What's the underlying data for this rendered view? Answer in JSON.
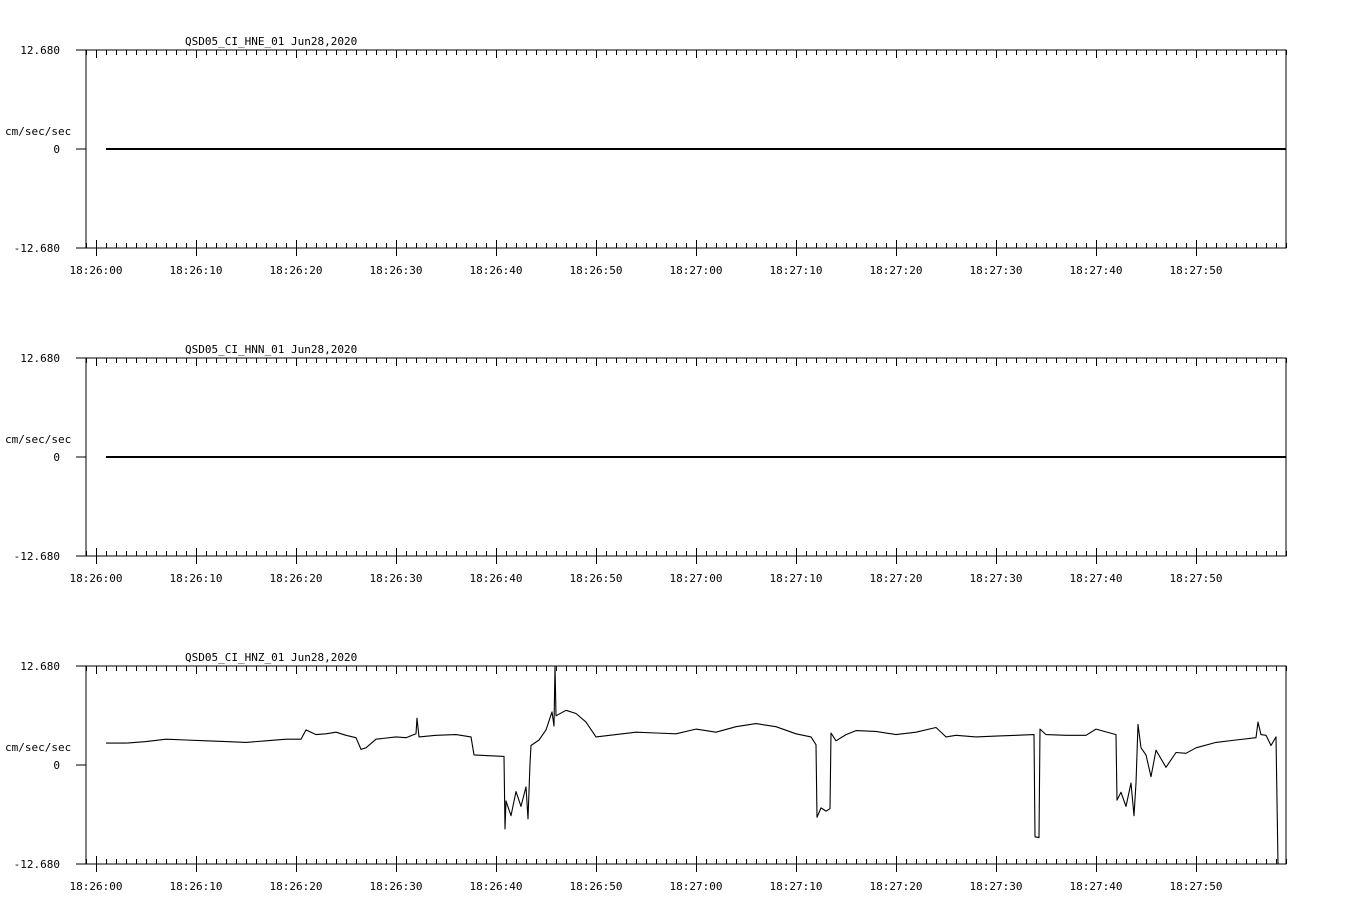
{
  "chart_data": [
    {
      "type": "line",
      "title": "QSD05_CI_HNE_01  Jun28,2020",
      "ylabel": "cm/sec/sec",
      "ylim": [
        -12.68,
        12.68
      ],
      "y_ticks": [
        "12.680",
        "0",
        "-12.680"
      ],
      "x_ticks": [
        "18:26:00",
        "18:26:10",
        "18:26:20",
        "18:26:30",
        "18:26:40",
        "18:26:50",
        "18:27:00",
        "18:27:10",
        "18:27:20",
        "18:27:30",
        "18:27:40",
        "18:27:50"
      ],
      "xlim_seconds": [
        -1,
        119
      ],
      "series": [
        {
          "points": [
            [
              1,
              0
            ],
            [
              119,
              0
            ]
          ]
        }
      ]
    },
    {
      "type": "line",
      "title": "QSD05_CI_HNN_01  Jun28,2020",
      "ylabel": "cm/sec/sec",
      "ylim": [
        -12.68,
        12.68
      ],
      "y_ticks": [
        "12.680",
        "0",
        "-12.680"
      ],
      "x_ticks": [
        "18:26:00",
        "18:26:10",
        "18:26:20",
        "18:26:30",
        "18:26:40",
        "18:26:50",
        "18:27:00",
        "18:27:10",
        "18:27:20",
        "18:27:30",
        "18:27:40",
        "18:27:50"
      ],
      "xlim_seconds": [
        -1,
        119
      ],
      "series": [
        {
          "points": [
            [
              1,
              0
            ],
            [
              119,
              0
            ]
          ]
        }
      ]
    },
    {
      "type": "line",
      "title": "QSD05_CI_HNZ_01  Jun28,2020",
      "ylabel": "cm/sec/sec",
      "ylim": [
        -12.68,
        12.68
      ],
      "y_ticks": [
        "12.680",
        "0",
        "-12.680"
      ],
      "x_ticks": [
        "18:26:00",
        "18:26:10",
        "18:26:20",
        "18:26:30",
        "18:26:40",
        "18:26:50",
        "18:27:00",
        "18:27:10",
        "18:27:20",
        "18:27:30",
        "18:27:40",
        "18:27:50"
      ],
      "xlim_seconds": [
        -1,
        119
      ],
      "series": [
        {
          "points": [
            [
              1,
              2.8
            ],
            [
              3,
              2.8
            ],
            [
              5,
              3.0
            ],
            [
              7,
              3.3
            ],
            [
              9,
              3.2
            ],
            [
              11,
              3.1
            ],
            [
              13,
              3.0
            ],
            [
              15,
              2.9
            ],
            [
              17,
              3.1
            ],
            [
              19,
              3.3
            ],
            [
              20.5,
              3.3
            ],
            [
              21,
              4.5
            ],
            [
              22,
              3.9
            ],
            [
              23,
              4.0
            ],
            [
              24,
              4.2
            ],
            [
              25,
              3.8
            ],
            [
              26,
              3.5
            ],
            [
              26.5,
              2.0
            ],
            [
              27,
              2.2
            ],
            [
              28,
              3.3
            ],
            [
              30,
              3.6
            ],
            [
              31,
              3.5
            ],
            [
              32,
              4.0
            ],
            [
              32.1,
              6.0
            ],
            [
              32.3,
              3.6
            ],
            [
              34,
              3.8
            ],
            [
              36,
              3.9
            ],
            [
              37.5,
              3.6
            ],
            [
              37.8,
              1.3
            ],
            [
              39,
              1.2
            ],
            [
              40.8,
              1.1
            ],
            [
              40.9,
              -8.2
            ],
            [
              41,
              -4.6
            ],
            [
              41.5,
              -6.5
            ],
            [
              42,
              -3.4
            ],
            [
              42.5,
              -5.3
            ],
            [
              43,
              -2.8
            ],
            [
              43.2,
              -6.9
            ],
            [
              43.4,
              0.2
            ],
            [
              43.5,
              2.5
            ],
            [
              44.3,
              3.2
            ],
            [
              45,
              4.5
            ],
            [
              45.6,
              6.8
            ],
            [
              45.8,
              5.0
            ],
            [
              45.9,
              12.68
            ],
            [
              46,
              6.3
            ],
            [
              47,
              7.0
            ],
            [
              48,
              6.6
            ],
            [
              49,
              5.5
            ],
            [
              50,
              3.6
            ],
            [
              52,
              3.9
            ],
            [
              54,
              4.2
            ],
            [
              56,
              4.1
            ],
            [
              58,
              4.0
            ],
            [
              60,
              4.6
            ],
            [
              62,
              4.2
            ],
            [
              64,
              4.9
            ],
            [
              66,
              5.3
            ],
            [
              68,
              4.9
            ],
            [
              70,
              4.0
            ],
            [
              71.5,
              3.6
            ],
            [
              72,
              2.6
            ],
            [
              72.1,
              -6.7
            ],
            [
              72.5,
              -5.5
            ],
            [
              73,
              -5.9
            ],
            [
              73.4,
              -5.6
            ],
            [
              73.5,
              4.1
            ],
            [
              74,
              3.1
            ],
            [
              75,
              3.9
            ],
            [
              76,
              4.4
            ],
            [
              78,
              4.3
            ],
            [
              80,
              3.9
            ],
            [
              82,
              4.2
            ],
            [
              84,
              4.8
            ],
            [
              85,
              3.6
            ],
            [
              86,
              3.8
            ],
            [
              88,
              3.6
            ],
            [
              90,
              3.7
            ],
            [
              92,
              3.8
            ],
            [
              93.8,
              3.9
            ],
            [
              93.9,
              -9.2
            ],
            [
              94.3,
              -9.3
            ],
            [
              94.4,
              4.6
            ],
            [
              95,
              3.9
            ],
            [
              97,
              3.8
            ],
            [
              99,
              3.8
            ],
            [
              100,
              4.6
            ],
            [
              102,
              3.9
            ],
            [
              102.1,
              -4.5
            ],
            [
              102.5,
              -3.5
            ],
            [
              103,
              -5.3
            ],
            [
              103.5,
              -2.3
            ],
            [
              103.8,
              -6.5
            ],
            [
              104,
              -2.3
            ],
            [
              104.2,
              5.2
            ],
            [
              104.5,
              2.2
            ],
            [
              105,
              1.3
            ],
            [
              105.5,
              -1.5
            ],
            [
              106,
              1.9
            ],
            [
              107,
              -0.3
            ],
            [
              108,
              1.6
            ],
            [
              109,
              1.5
            ],
            [
              110,
              2.2
            ],
            [
              112,
              2.9
            ],
            [
              114,
              3.2
            ],
            [
              116,
              3.5
            ],
            [
              116.2,
              5.5
            ],
            [
              116.5,
              3.9
            ],
            [
              117,
              3.8
            ],
            [
              117.5,
              2.5
            ],
            [
              118,
              3.6
            ],
            [
              118.2,
              -14.0
            ],
            [
              118.4,
              -16.5
            ],
            [
              118.6,
              -14.0
            ],
            [
              118.8,
              -16.0
            ],
            [
              119,
              -14.0
            ]
          ]
        }
      ]
    }
  ]
}
